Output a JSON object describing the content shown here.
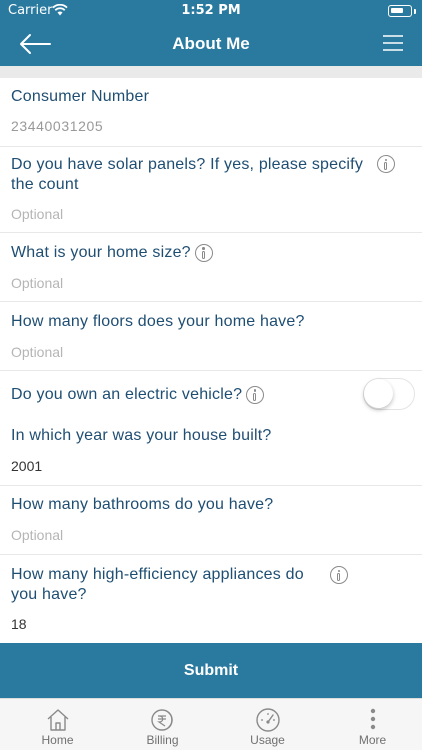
{
  "status_bar": {
    "carrier": "Carrier",
    "time": "1:52 PM"
  },
  "header": {
    "title": "About Me"
  },
  "fields": {
    "consumer_number": {
      "label": "Consumer Number",
      "value": "23440031205"
    },
    "solar_panels": {
      "label": "Do you have solar panels? If yes, please specify the count",
      "placeholder": "Optional"
    },
    "home_size": {
      "label": "What is your home size?",
      "placeholder": "Optional"
    },
    "floors": {
      "label": "How many floors does your home have?",
      "placeholder": "Optional"
    },
    "electric_vehicle": {
      "label": "Do you own an electric vehicle?",
      "toggle_on": false
    },
    "year_built": {
      "label": "In which year was your house built?",
      "value": "2001"
    },
    "bathrooms": {
      "label": "How many bathrooms do you have?",
      "placeholder": "Optional"
    },
    "appliances": {
      "label": "How many high-efficiency appliances do you have?",
      "value": "18"
    }
  },
  "submit_label": "Submit",
  "tabs": [
    {
      "label": "Home",
      "icon": "home-icon"
    },
    {
      "label": "Billing",
      "icon": "rupee-icon"
    },
    {
      "label": "Usage",
      "icon": "gauge-icon"
    },
    {
      "label": "More",
      "icon": "more-vertical-icon"
    }
  ],
  "colors": {
    "primary": "#2a7aa0",
    "label": "#1f4e73",
    "placeholder": "#b5b5b5"
  }
}
